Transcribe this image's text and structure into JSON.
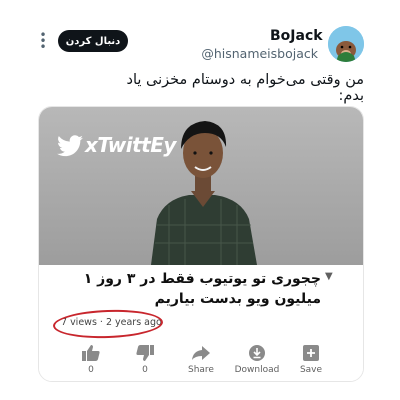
{
  "tweet": {
    "display_name": "BoJack",
    "handle": "@hisnameisbojack",
    "follow_label": "دنبال کردن",
    "text": "من وقتی می‌خوام به دوستام مخزنی یاد بدم:"
  },
  "media": {
    "watermark": "xTwittEy",
    "video_title": "چجوری تو یوتیوب فقط در ۳ روز ۱ میلیون ویو بدست بیاریم",
    "meta": "7 views · 2 years ago",
    "actions": [
      {
        "icon": "thumbs-up-icon",
        "label": "0"
      },
      {
        "icon": "thumbs-down-icon",
        "label": "0"
      },
      {
        "icon": "share-icon",
        "label": "Share"
      },
      {
        "icon": "download-icon",
        "label": "Download"
      },
      {
        "icon": "save-icon",
        "label": "Save"
      }
    ]
  },
  "colors": {
    "follow_button_bg": "#0f1419",
    "highlight_circle": "#c8262d",
    "avatar_bg": "#7fc6e8"
  }
}
